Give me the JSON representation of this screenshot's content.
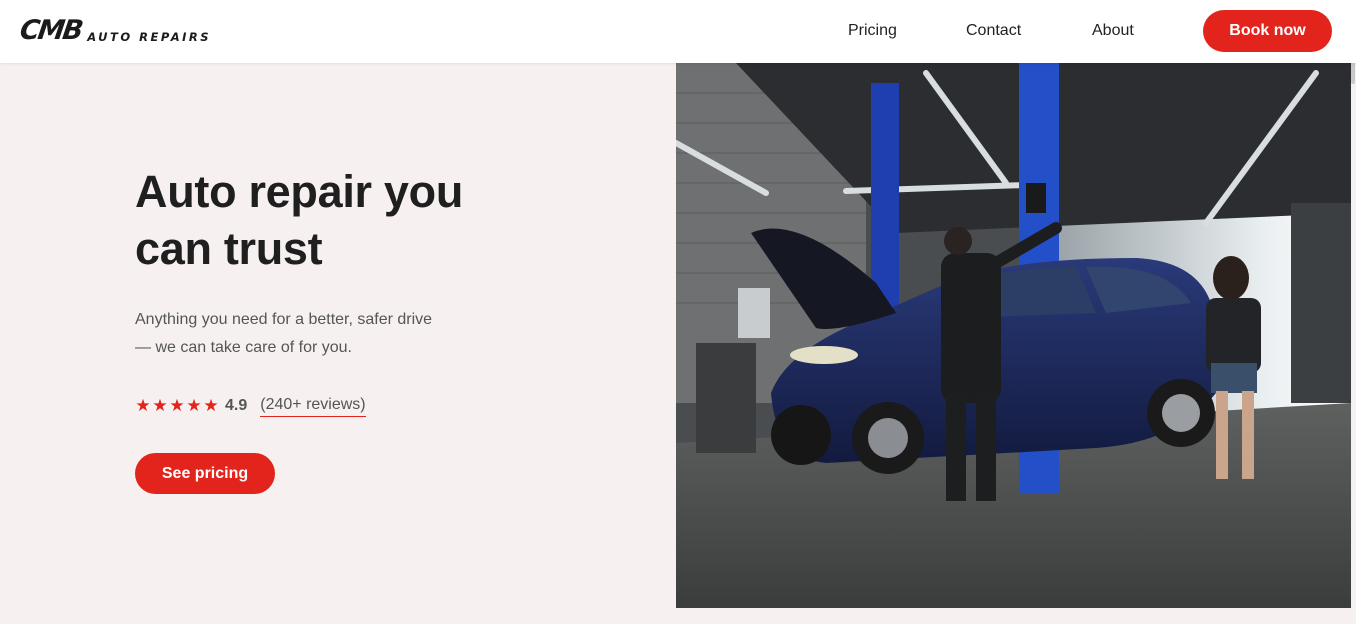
{
  "header": {
    "logo_main": "CMB",
    "logo_sub": "AUTO REPAIRS",
    "nav": [
      {
        "label": "Pricing"
      },
      {
        "label": "Contact"
      },
      {
        "label": "About"
      }
    ],
    "cta_label": "Book now"
  },
  "hero": {
    "title_line1": "Auto repair you",
    "title_line2": "can trust",
    "subtitle_line1": "Anything you need for a better, safer drive",
    "subtitle_line2": "— we can take care of for you.",
    "stars": 5,
    "rating": "4.9",
    "reviews": "(240+ reviews)",
    "button_label": "See pricing"
  },
  "colors": {
    "accent": "#e3241c",
    "background": "#f6f1f0",
    "header_bg": "#ffffff"
  }
}
